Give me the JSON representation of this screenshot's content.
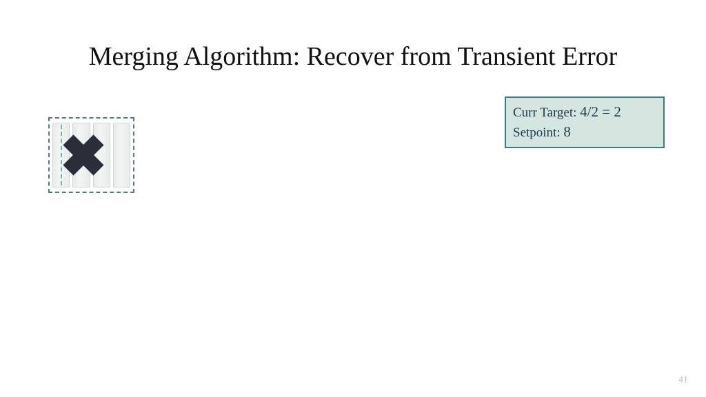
{
  "title": "Merging Algorithm: Recover from Transient Error",
  "status": {
    "curr_target_label": "Curr Target:",
    "curr_target_value": "4/2 = 2",
    "setpoint_label": "Setpoint:",
    "setpoint_value": "8"
  },
  "page_number": "41"
}
